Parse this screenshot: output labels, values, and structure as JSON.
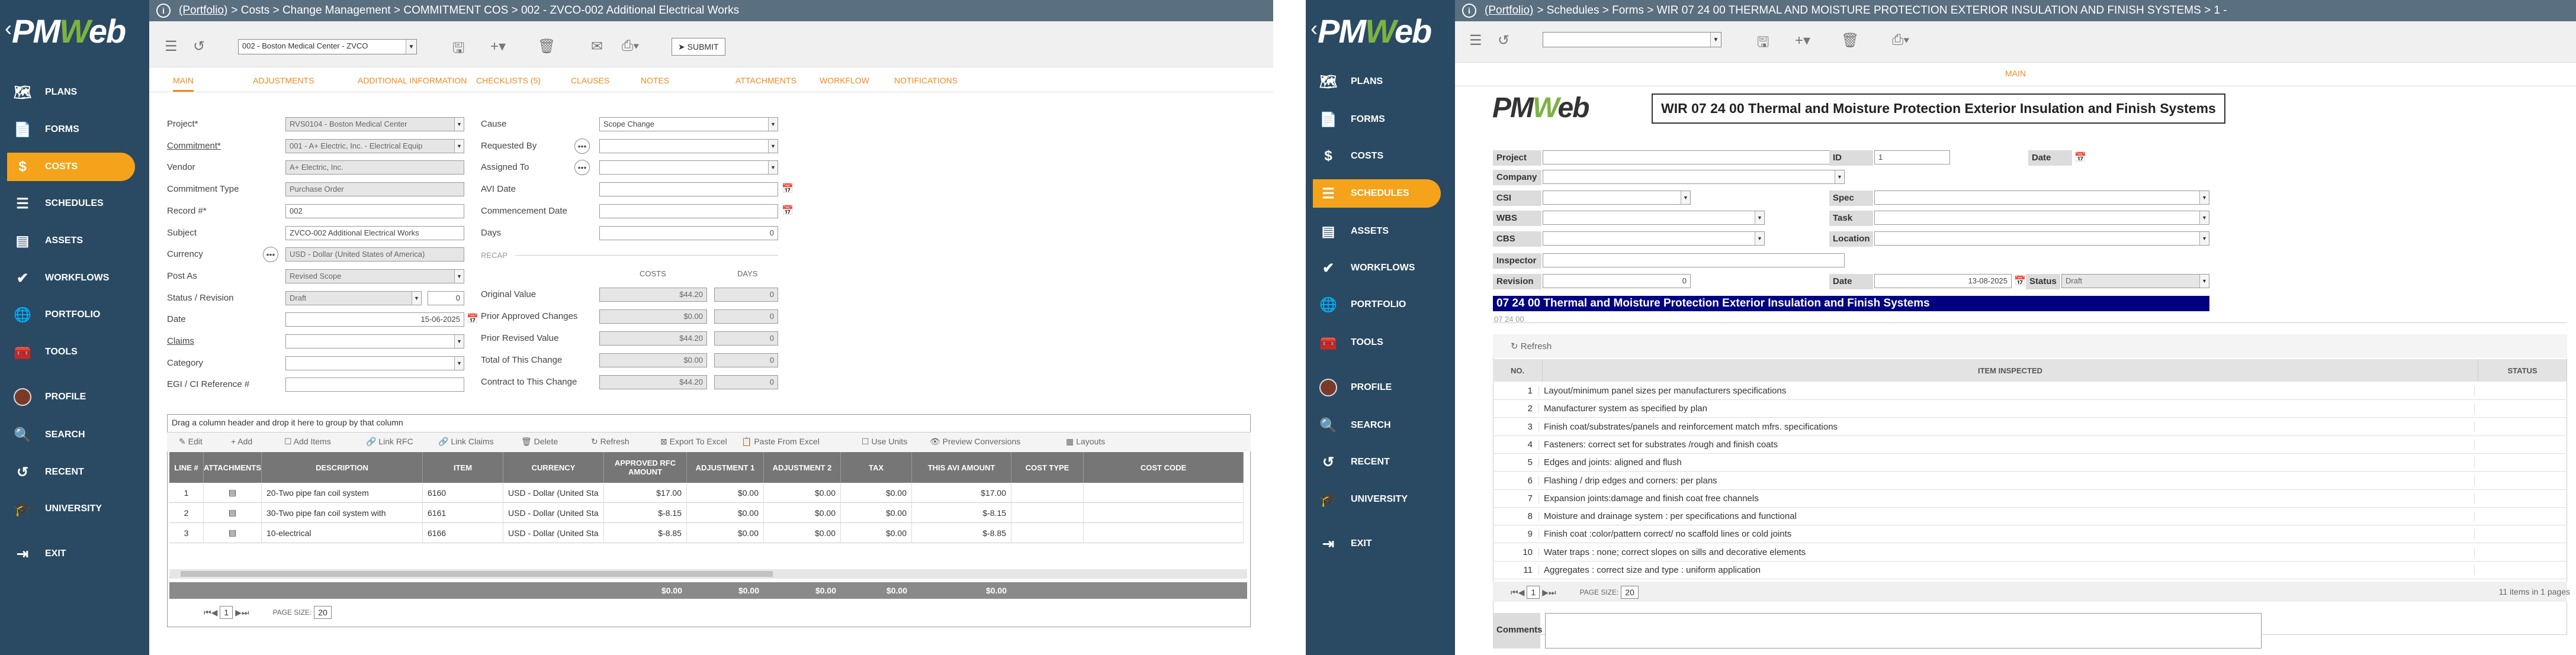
{
  "logo": {
    "pre": "PM",
    "mark": "W",
    "post": "eb"
  },
  "left_app": {
    "nav": [
      {
        "icon": "map-icon",
        "label": "Plans"
      },
      {
        "icon": "forms-icon",
        "label": "Forms"
      },
      {
        "icon": "dollar-icon",
        "label": "Costs"
      },
      {
        "icon": "schedules-icon",
        "label": "Schedules"
      },
      {
        "icon": "assets-icon",
        "label": "Assets"
      },
      {
        "icon": "check-icon",
        "label": "Workflows"
      },
      {
        "icon": "globe-icon",
        "label": "Portfolio"
      },
      {
        "icon": "toolbox-icon",
        "label": "Tools"
      },
      {
        "icon": "avatar",
        "label": "Profile"
      },
      {
        "icon": "search-icon",
        "label": "Search"
      },
      {
        "icon": "history-icon",
        "label": "Recent"
      },
      {
        "icon": "graduation-icon",
        "label": "University"
      },
      {
        "icon": "exit-icon",
        "label": "Exit"
      }
    ],
    "active_nav": "Costs",
    "breadcrumb": {
      "portfolio": "(Portfolio)",
      "rest": " > Costs > Change Management > COMMITMENT COS > 002 - ZVCO-002 Additional Electrical Works"
    },
    "project_select": "002 - Boston Medical Center - ZVCO",
    "submit_label": "SUBMIT",
    "tabs": [
      "Main",
      "Adjustments",
      "Additional Information",
      "Checklists (5)",
      "Clauses",
      "Notes",
      "Attachments",
      "Workflow",
      "Notifications"
    ],
    "form_left": [
      {
        "label": "Project*",
        "value": "RVS0104 - Boston Medical Center",
        "ro": true,
        "dd": true
      },
      {
        "label": "Commitment*",
        "value": "001 - A+ Electric, Inc. - Electrical Equip",
        "ro": true,
        "dd": true,
        "underline": true
      },
      {
        "label": "Vendor",
        "value": "A+ Electric, Inc.",
        "ro": true,
        "dd": false
      },
      {
        "label": "Commitment Type",
        "value": "Purchase Order",
        "ro": true,
        "dd": false
      },
      {
        "label": "Record #*",
        "value": "002",
        "ro": false,
        "dd": false
      },
      {
        "label": "Subject",
        "value": "ZVCO-002 Additional Electrical Works",
        "ro": false,
        "dd": false
      },
      {
        "label": "Currency",
        "value": "USD - Dollar (United States of America)",
        "ro": true,
        "dd": false
      },
      {
        "label": "Post As",
        "value": "Revised Scope",
        "ro": true,
        "dd": true
      },
      {
        "label": "Status / Revision",
        "value": "Draft",
        "ro": true,
        "dd": true
      },
      {
        "label": "Date",
        "value": "15-06-2025",
        "ro": false,
        "dd": false
      },
      {
        "label": "Claims",
        "value": "",
        "ro": false,
        "dd": true,
        "underline": true
      },
      {
        "label": "Category",
        "value": "",
        "ro": false,
        "dd": true
      },
      {
        "label": "EGI / CI Reference #",
        "value": "",
        "ro": false,
        "dd": false
      }
    ],
    "revision_value": "0",
    "form_right": [
      {
        "label": "Cause",
        "value": "Scope Change"
      },
      {
        "label": "Requested By",
        "value": ""
      },
      {
        "label": "Assigned To",
        "value": ""
      },
      {
        "label": "AVI Date",
        "value": ""
      },
      {
        "label": "Commencement Date",
        "value": ""
      },
      {
        "label": "Days",
        "value": "0"
      }
    ],
    "recap": {
      "title": "RECAP",
      "costs": "COSTS",
      "days": "DAYS"
    },
    "recap_rows": [
      {
        "label": "Original Value",
        "cost": "$44.20",
        "days": "0"
      },
      {
        "label": "Prior Approved Changes",
        "cost": "$0.00",
        "days": "0"
      },
      {
        "label": "Prior Revised Value",
        "cost": "$44.20",
        "days": "0"
      },
      {
        "label": "Total of This Change",
        "cost": "$0.00",
        "days": "0"
      },
      {
        "label": "Contract to This Change",
        "cost": "$44.20",
        "days": "0"
      }
    ],
    "grid": {
      "group_hint": "Drag a column header and drop it here to group by that column",
      "tools": [
        "Edit",
        "Add",
        "Add Items",
        "Link RFC",
        "Link Claims",
        "Delete",
        "Refresh",
        "Export To Excel",
        "Paste From Excel",
        "Use Units",
        "Preview Conversions",
        "Layouts"
      ],
      "headers": [
        "LINE #",
        "ATTACHMENTS",
        "DESCRIPTION",
        "ITEM",
        "CURRENCY",
        "APPROVED RFC AMOUNT",
        "ADJUSTMENT 1",
        "ADJUSTMENT 2",
        "TAX",
        "THIS AVI AMOUNT",
        "COST TYPE",
        "COST CODE"
      ],
      "rows": [
        [
          "1",
          "",
          "20-Two pipe fan coil system",
          "6160",
          "USD - Dollar (United Sta",
          "$17.00",
          "$0.00",
          "$0.00",
          "$0.00",
          "$17.00",
          "",
          ""
        ],
        [
          "2",
          "",
          "30-Two pipe fan coil system with",
          "6161",
          "USD - Dollar (United Sta",
          "$-8.15",
          "$0.00",
          "$0.00",
          "$0.00",
          "$-8.15",
          "",
          ""
        ],
        [
          "3",
          "",
          "10-electrical",
          "6166",
          "USD - Dollar (United Sta",
          "$-8.85",
          "$0.00",
          "$0.00",
          "$0.00",
          "$-8.85",
          "",
          ""
        ]
      ],
      "totals": [
        "$0.00",
        "$0.00",
        "$0.00",
        "$0.00",
        "$0.00"
      ],
      "page_current": "1",
      "page_size_label": "PAGE SIZE:",
      "page_size": "20"
    }
  },
  "right_app": {
    "nav": [
      {
        "icon": "map-icon",
        "label": "Plans"
      },
      {
        "icon": "forms-icon",
        "label": "Forms"
      },
      {
        "icon": "dollar-icon",
        "label": "Costs"
      },
      {
        "icon": "schedules-icon",
        "label": "Schedules"
      },
      {
        "icon": "assets-icon",
        "label": "Assets"
      },
      {
        "icon": "check-icon",
        "label": "Workflows"
      },
      {
        "icon": "globe-icon",
        "label": "Portfolio"
      },
      {
        "icon": "toolbox-icon",
        "label": "Tools"
      },
      {
        "icon": "avatar",
        "label": "Profile"
      },
      {
        "icon": "search-icon",
        "label": "Search"
      },
      {
        "icon": "history-icon",
        "label": "Recent"
      },
      {
        "icon": "graduation-icon",
        "label": "University"
      },
      {
        "icon": "exit-icon",
        "label": "Exit"
      }
    ],
    "active_nav": "Schedules",
    "breadcrumb": {
      "portfolio": "(Portfolio)",
      "rest": " > Schedules > Forms > WIR 07 24 00 THERMAL AND MOISTURE PROTECTION EXTERIOR INSULATION AND FINISH SYSTEMS > 1 -"
    },
    "tab_main": "MAIN",
    "form_title": "WIR 07 24 00 Thermal and Moisture Protection Exterior Insulation and Finish Systems",
    "fields": {
      "project": "Project",
      "company": "Company",
      "csi": "CSI",
      "wbs": "WBS",
      "cbs": "CBS",
      "inspector": "Inspector",
      "revision": "Revision",
      "revision_value": "0",
      "id": "ID",
      "id_value": "1",
      "date": "Date",
      "spec": "Spec",
      "task": "Task",
      "location": "Location",
      "date2": "Date",
      "date2_value": "13-08-2025",
      "status": "Status",
      "status_value": "Draft"
    },
    "section_band": "07 24 00 Thermal and Moisture Protection Exterior Insulation and Finish Systems",
    "section_code": "07 24 00",
    "refresh_label": "Refresh",
    "table_headers": [
      "NO.",
      "ITEM INSPECTED",
      "STATUS"
    ],
    "items": [
      "Layout/minimum panel sizes per manufacturers specifications",
      "Manufacturer system as specified by plan",
      "Finish coat/substrates/panels and reinforcement match mfrs. specifications",
      "Fasteners: correct set for substrates /rough and finish coats",
      "Edges and joints: aligned and flush",
      "Flashing / drip edges and corners: per plans",
      "Expansion joints:damage and finish coat free channels",
      "Moisture and drainage system : per specifications and functional",
      "Finish coat :color/pattern correct/ no scaffold lines or cold joints",
      "Water traps : none; correct slopes on sills and decorative elements",
      "Aggregates : correct size and type : uniform application"
    ],
    "page_current": "1",
    "page_size_label": "PAGE SIZE:",
    "page_size": "20",
    "items_count": "11 items in 1 pages",
    "comments_label": "Comments"
  }
}
